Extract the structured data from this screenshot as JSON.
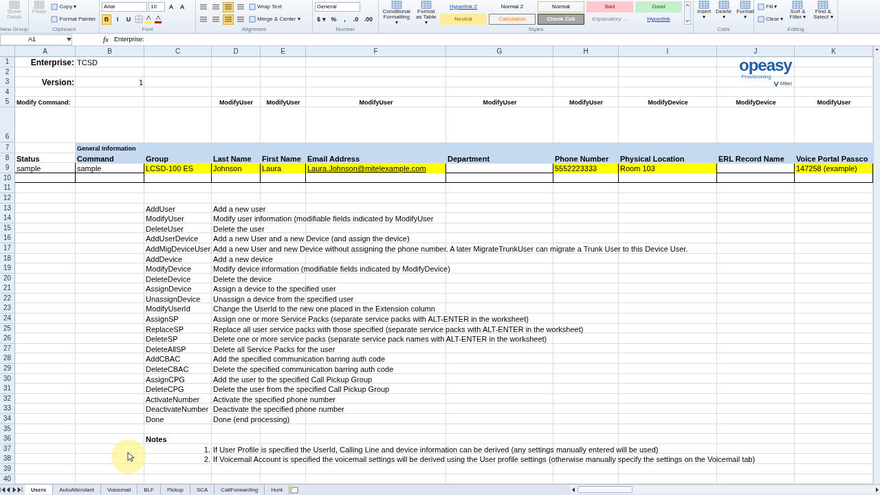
{
  "ribbon": {
    "groups": [
      {
        "label": "New Group",
        "items": [
          {
            "kind": "large",
            "label": "Show Detail",
            "disabled": true
          }
        ]
      },
      {
        "label": "Clipboard",
        "items": [
          {
            "kind": "large",
            "label": "Paste",
            "disabled": true
          },
          {
            "kind": "stack",
            "rows": [
              [
                {
                  "kind": "small",
                  "label": "Copy ▾"
                }
              ],
              [
                {
                  "kind": "small",
                  "label": "Format Painter"
                }
              ]
            ]
          }
        ]
      },
      {
        "label": "Font",
        "items": [
          {
            "kind": "stack",
            "rows": [
              [
                {
                  "kind": "dropdown",
                  "value": "Arial"
                },
                {
                  "kind": "dropdown",
                  "value": "10"
                },
                {
                  "kind": "text",
                  "label": "A",
                  "selected": false
                },
                {
                  "kind": "text",
                  "label": "A",
                  "selected": false
                }
              ],
              [
                {
                  "kind": "text",
                  "label": "B",
                  "selected": true
                },
                {
                  "kind": "text",
                  "label": "I",
                  "selected": false
                },
                {
                  "kind": "text",
                  "label": "U",
                  "selected": false
                },
                {
                  "kind": "grid"
                },
                {
                  "kind": "swatch",
                  "color": "#ffff00"
                },
                {
                  "kind": "swatch",
                  "color": "#c00000"
                }
              ]
            ]
          }
        ]
      },
      {
        "label": "Alignment",
        "items": [
          {
            "kind": "stack",
            "rows": [
              [
                {
                  "kind": "lines",
                  "selected": false
                },
                {
                  "kind": "lines",
                  "selected": false
                },
                {
                  "kind": "lines",
                  "selected": true
                },
                {
                  "kind": "lines",
                  "selected": false
                },
                {
                  "kind": "small",
                  "label": "Wrap Text"
                }
              ],
              [
                {
                  "kind": "lines",
                  "selected": false
                },
                {
                  "kind": "lines",
                  "selected": false
                },
                {
                  "kind": "lines",
                  "selected": true
                },
                {
                  "kind": "lines",
                  "selected": false
                },
                {
                  "kind": "small",
                  "label": "Merge & Center ▾"
                }
              ]
            ]
          }
        ]
      },
      {
        "label": "Number",
        "items": [
          {
            "kind": "stack",
            "rows": [
              [
                {
                  "kind": "dropdown",
                  "value": "General"
                }
              ],
              [
                {
                  "kind": "text",
                  "label": "$ ▾",
                  "selected": false
                },
                {
                  "kind": "text",
                  "label": "%",
                  "selected": false
                },
                {
                  "kind": "text",
                  "label": ",",
                  "selected": false
                },
                {
                  "kind": "text",
                  "label": ".0",
                  "selected": false
                },
                {
                  "kind": "text",
                  "label": ".00",
                  "selected": false
                }
              ]
            ]
          }
        ]
      },
      {
        "label": "Styles",
        "items": [
          {
            "kind": "large",
            "label": "Conditional Formatting ▾",
            "disabled": false
          },
          {
            "kind": "large",
            "label": "Format as Table ▾",
            "disabled": false
          },
          {
            "kind": "gallery",
            "styles": [
              {
                "label": "Hyperlink 2",
                "kind": "link",
                "selected": false
              },
              {
                "label": "Normal 2",
                "kind": "plain",
                "selected": false
              },
              {
                "label": "Normal",
                "kind": "plain",
                "selected": true
              },
              {
                "label": "Bad",
                "kind": "bad",
                "selected": false
              },
              {
                "label": "Good",
                "kind": "good",
                "selected": false
              },
              {
                "label": "Neutral",
                "kind": "neutral",
                "selected": false
              },
              {
                "label": "Calculation",
                "kind": "calculation",
                "selected": false
              },
              {
                "label": "Check Cell",
                "kind": "check",
                "selected": false
              },
              {
                "label": "Explanatory ...",
                "kind": "explanatory",
                "selected": false
              },
              {
                "label": "Hyperlink",
                "kind": "link",
                "selected": false
              }
            ]
          }
        ]
      },
      {
        "label": "Cells",
        "items": [
          {
            "kind": "large",
            "label": "Insert ▾",
            "disabled": false
          },
          {
            "kind": "large",
            "label": "Delete ▾",
            "disabled": false
          },
          {
            "kind": "large",
            "label": "Format ▾",
            "disabled": false
          }
        ]
      },
      {
        "label": "Editing",
        "items": [
          {
            "kind": "stack",
            "rows": [
              [
                {
                  "kind": "small",
                  "label": "Fill ▾"
                }
              ],
              [
                {
                  "kind": "small",
                  "label": "Clear ▾"
                }
              ]
            ]
          },
          {
            "kind": "large",
            "label": "Sort & Filter ▾",
            "disabled": false
          },
          {
            "kind": "large",
            "label": "Find & Select ▾",
            "disabled": false
          }
        ]
      }
    ]
  },
  "formula_bar": {
    "name_box": "A1",
    "function_label": "fx",
    "formula": "Enterprise:"
  },
  "sheet": {
    "columns": [
      "A",
      "B",
      "C",
      "D",
      "E",
      "F",
      "G",
      "H",
      "I",
      "J",
      "K"
    ],
    "logo": {
      "name": "opeasy",
      "tagline": "Provisioning",
      "brand": "Mitel"
    },
    "rows": [
      {
        "number": "1",
        "cells": [
          {
            "text": "Enterprise:",
            "kind": "label"
          },
          {
            "text": "TCSD"
          }
        ]
      },
      {
        "number": "2"
      },
      {
        "number": "3",
        "cells": [
          {
            "text": "Version:",
            "kind": "label"
          },
          {
            "text": "1",
            "kind": "number"
          }
        ]
      },
      {
        "number": "4"
      },
      {
        "number": "5",
        "cells": [
          {
            "text": "Modify Command:",
            "kind": "command"
          },
          null,
          null,
          {
            "text": "ModifyUser",
            "kind": "command"
          },
          {
            "text": "ModifyUser",
            "kind": "command"
          },
          {
            "text": "ModifyUser",
            "kind": "command"
          },
          {
            "text": "ModifyUser",
            "kind": "command"
          },
          {
            "text": "ModifyUser",
            "kind": "command"
          },
          {
            "text": "ModifyDevice",
            "kind": "command"
          },
          {
            "text": "ModifyDevice",
            "kind": "command"
          },
          {
            "text": "ModifyUser",
            "kind": "command"
          }
        ]
      },
      {
        "number": "6",
        "kind": "spacer"
      },
      {
        "number": "7",
        "color": "#c5d9f1",
        "cells": [
          null,
          {
            "text": "General Information",
            "kind": "section"
          }
        ]
      },
      {
        "number": "8",
        "color": "#c5d9f1",
        "cells": [
          {
            "text": "Status",
            "kind": "heading"
          },
          {
            "text": "Command",
            "kind": "heading"
          },
          {
            "text": "Group",
            "kind": "heading"
          },
          {
            "text": "Last Name",
            "kind": "heading"
          },
          {
            "text": "First Name",
            "kind": "heading"
          },
          {
            "text": "Email Address",
            "kind": "heading"
          },
          {
            "text": "Department",
            "kind": "heading"
          },
          {
            "text": "Phone Number",
            "kind": "heading"
          },
          {
            "text": "Physical Location",
            "kind": "heading"
          },
          {
            "text": "ERL Record Name",
            "kind": "heading"
          },
          {
            "text": "Voice Portal Passco",
            "kind": "heading"
          }
        ]
      },
      {
        "number": "9",
        "kind": "bordered",
        "cells": [
          {
            "text": "sample"
          },
          {
            "text": "sample"
          },
          {
            "text": "LCSD-100 ES",
            "color": "#ffff00"
          },
          {
            "text": "Johnson",
            "color": "#ffff00"
          },
          {
            "text": "Laura",
            "color": "#ffff00"
          },
          {
            "text": "Laura.Johnson@mitelexample.com",
            "kind": "link",
            "color": "#ffff00"
          },
          null,
          {
            "text": "5552223333",
            "color": "#ffff00"
          },
          {
            "text": "Room 103",
            "color": "#ffff00"
          },
          null,
          {
            "text": "147258 (example)",
            "color": "#ffff00"
          }
        ]
      },
      {
        "number": "10",
        "kind": "bordered"
      },
      {
        "number": "11"
      },
      {
        "number": "12"
      },
      {
        "number": "13",
        "cells": [
          null,
          null,
          {
            "text": "AddUser"
          },
          {
            "text": "Add a new user"
          }
        ]
      },
      {
        "number": "14",
        "cells": [
          null,
          null,
          {
            "text": "ModifyUser"
          },
          {
            "text": "Modify user information (modifiable fields indicated by ModifyUser"
          }
        ]
      },
      {
        "number": "15",
        "cells": [
          null,
          null,
          {
            "text": "DeleteUser"
          },
          {
            "text": "Delete the user"
          }
        ]
      },
      {
        "number": "16",
        "cells": [
          null,
          null,
          {
            "text": "AddUserDevice"
          },
          {
            "text": "Add a new User and a new Device (and assign the device)"
          }
        ]
      },
      {
        "number": "17",
        "cells": [
          null,
          null,
          {
            "text": "AddMigDeviceUser"
          },
          {
            "text": "Add a new User and new Device without assigning the phone number.  A later MigrateTrunkUser can migrate a Trunk User to this Device User."
          }
        ]
      },
      {
        "number": "18",
        "cells": [
          null,
          null,
          {
            "text": "AddDevice"
          },
          {
            "text": "Add a new device"
          }
        ]
      },
      {
        "number": "19",
        "cells": [
          null,
          null,
          {
            "text": "ModifyDevice"
          },
          {
            "text": "Modify device information (modifiable fields indicated by ModifyDevice)"
          }
        ]
      },
      {
        "number": "20",
        "cells": [
          null,
          null,
          {
            "text": "DeleteDevice"
          },
          {
            "text": "Delete the device"
          }
        ]
      },
      {
        "number": "21",
        "cells": [
          null,
          null,
          {
            "text": "AssignDevice"
          },
          {
            "text": "Assign a device to the specified user"
          }
        ]
      },
      {
        "number": "22",
        "cells": [
          null,
          null,
          {
            "text": "UnassignDevice"
          },
          {
            "text": "Unassign a device from the specified user"
          }
        ]
      },
      {
        "number": "23",
        "cells": [
          null,
          null,
          {
            "text": "ModifyUserId"
          },
          {
            "text": "Change the UserId to the new one placed in the Extension column"
          }
        ]
      },
      {
        "number": "24",
        "cells": [
          null,
          null,
          {
            "text": "AssignSP"
          },
          {
            "text": "Assign one or more Service Packs (separate service packs with ALT-ENTER in the worksheet)"
          }
        ]
      },
      {
        "number": "25",
        "cells": [
          null,
          null,
          {
            "text": "ReplaceSP"
          },
          {
            "text": "Replace all user service packs with those specified (separate service packs with ALT-ENTER in the worksheet)"
          }
        ]
      },
      {
        "number": "26",
        "cells": [
          null,
          null,
          {
            "text": "DeleteSP"
          },
          {
            "text": "Delete one or more service packs (separate service pack names with ALT-ENTER in the worksheet)"
          }
        ]
      },
      {
        "number": "27",
        "cells": [
          null,
          null,
          {
            "text": "DeleteAllSP"
          },
          {
            "text": "Delete all Service Packs for the user"
          }
        ]
      },
      {
        "number": "28",
        "cells": [
          null,
          null,
          {
            "text": "AddCBAC"
          },
          {
            "text": "Add the specified communication barring auth code"
          }
        ]
      },
      {
        "number": "29",
        "cells": [
          null,
          null,
          {
            "text": "DeleteCBAC"
          },
          {
            "text": "Delete the specified communication barring auth code"
          }
        ]
      },
      {
        "number": "30",
        "cells": [
          null,
          null,
          {
            "text": "AssignCPG"
          },
          {
            "text": "Add the user to the specified Call Pickup Group"
          }
        ]
      },
      {
        "number": "31",
        "cells": [
          null,
          null,
          {
            "text": "DeleteCPG"
          },
          {
            "text": "Delete the user from the specified Call Pickup Group"
          }
        ]
      },
      {
        "number": "32",
        "cells": [
          null,
          null,
          {
            "text": "ActivateNumber"
          },
          {
            "text": "Activate the specified phone number"
          }
        ]
      },
      {
        "number": "33",
        "cells": [
          null,
          null,
          {
            "text": "DeactivateNumber"
          },
          {
            "text": "Deactivate the specified phone number"
          }
        ]
      },
      {
        "number": "34",
        "cells": [
          null,
          null,
          {
            "text": "Done"
          },
          {
            "text": "Done (end processing)"
          }
        ]
      },
      {
        "number": "35"
      },
      {
        "number": "36",
        "cells": [
          null,
          null,
          {
            "text": "Notes",
            "kind": "heading"
          }
        ]
      },
      {
        "number": "37",
        "cells": [
          null,
          null,
          {
            "text": "1.",
            "kind": "number"
          },
          {
            "text": "If User Profile is specified the UserId, Calling Line and device information can be derived (any settings manually entered will be used)"
          }
        ]
      },
      {
        "number": "38",
        "cells": [
          null,
          null,
          {
            "text": "2.",
            "kind": "number"
          },
          {
            "text": "If Voicemail Account is specified the voicemail settings will be derived using the User profile settings (otherwise manually specify the settings on the Voicemail tab)"
          }
        ]
      },
      {
        "number": "39"
      },
      {
        "number": "40"
      }
    ]
  },
  "sheet_tabs": [
    {
      "label": "Users",
      "selected": true
    },
    {
      "label": "AutoAttendant",
      "selected": false
    },
    {
      "label": "Voicemail",
      "selected": false
    },
    {
      "label": "BLF",
      "selected": false
    },
    {
      "label": "Pickup",
      "selected": false
    },
    {
      "label": "SCA",
      "selected": false
    },
    {
      "label": "CallForwarding",
      "selected": false
    },
    {
      "label": "Hunt",
      "selected": false
    }
  ]
}
